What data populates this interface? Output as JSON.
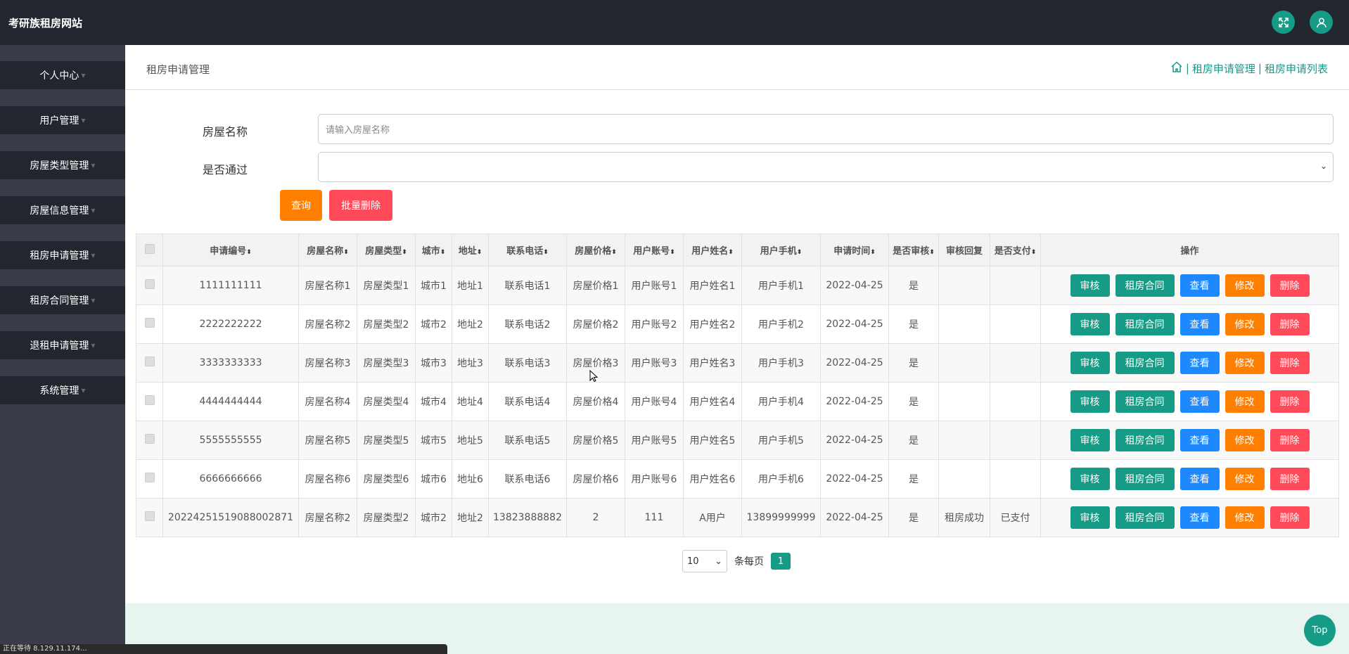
{
  "app": {
    "title": "考研族租房网站"
  },
  "colors": {
    "accent": "#169b86",
    "topbar": "#23262e",
    "sidebar": "#393d49",
    "search_btn": "#ff7f00",
    "danger_btn": "#ff4a5a",
    "view_btn": "#1e88ff",
    "edit_btn": "#ff7f00",
    "audit_btn": "#169b86"
  },
  "header_icons": [
    "fullscreen-icon",
    "user-icon"
  ],
  "sidebar": {
    "items": [
      {
        "label": "个人中心"
      },
      {
        "label": "用户管理"
      },
      {
        "label": "房屋类型管理"
      },
      {
        "label": "房屋信息管理"
      },
      {
        "label": "租房申请管理"
      },
      {
        "label": "租房合同管理"
      },
      {
        "label": "退租申请管理"
      },
      {
        "label": "系统管理"
      }
    ]
  },
  "page": {
    "title": "租房申请管理",
    "breadcrumb": [
      "租房申请管理",
      "租房申请列表"
    ]
  },
  "search": {
    "name_label": "房屋名称",
    "name_placeholder": "请输入房屋名称",
    "pass_label": "是否通过",
    "pass_value": "",
    "query_label": "查询",
    "batch_delete_label": "批量删除"
  },
  "table": {
    "columns": [
      "申请编号",
      "房屋名称",
      "房屋类型",
      "城市",
      "地址",
      "联系电话",
      "房屋价格",
      "用户账号",
      "用户姓名",
      "用户手机",
      "申请时间",
      "是否审核",
      "审核回复",
      "是否支付",
      "操作"
    ],
    "actions": [
      "审核",
      "租房合同",
      "查看",
      "修改",
      "删除"
    ],
    "rows": [
      [
        "1111111111",
        "房屋名称1",
        "房屋类型1",
        "城市1",
        "地址1",
        "联系电话1",
        "房屋价格1",
        "用户账号1",
        "用户姓名1",
        "用户手机1",
        "2022-04-25",
        "是",
        "",
        ""
      ],
      [
        "2222222222",
        "房屋名称2",
        "房屋类型2",
        "城市2",
        "地址2",
        "联系电话2",
        "房屋价格2",
        "用户账号2",
        "用户姓名2",
        "用户手机2",
        "2022-04-25",
        "是",
        "",
        ""
      ],
      [
        "3333333333",
        "房屋名称3",
        "房屋类型3",
        "城市3",
        "地址3",
        "联系电话3",
        "房屋价格3",
        "用户账号3",
        "用户姓名3",
        "用户手机3",
        "2022-04-25",
        "是",
        "",
        ""
      ],
      [
        "4444444444",
        "房屋名称4",
        "房屋类型4",
        "城市4",
        "地址4",
        "联系电话4",
        "房屋价格4",
        "用户账号4",
        "用户姓名4",
        "用户手机4",
        "2022-04-25",
        "是",
        "",
        ""
      ],
      [
        "5555555555",
        "房屋名称5",
        "房屋类型5",
        "城市5",
        "地址5",
        "联系电话5",
        "房屋价格5",
        "用户账号5",
        "用户姓名5",
        "用户手机5",
        "2022-04-25",
        "是",
        "",
        ""
      ],
      [
        "6666666666",
        "房屋名称6",
        "房屋类型6",
        "城市6",
        "地址6",
        "联系电话6",
        "房屋价格6",
        "用户账号6",
        "用户姓名6",
        "用户手机6",
        "2022-04-25",
        "是",
        "",
        ""
      ],
      [
        "20224251519088002871",
        "房屋名称2",
        "房屋类型2",
        "城市2",
        "地址2",
        "13823888882",
        "2",
        "111",
        "A用户",
        "13899999999",
        "2022-04-25",
        "是",
        "租房成功",
        "已支付"
      ]
    ]
  },
  "pager": {
    "page_size": "10",
    "per_page_label": "条每页",
    "current_page": "1"
  },
  "top_button": "Top",
  "status_text": "正在等待 8.129.11.174..."
}
